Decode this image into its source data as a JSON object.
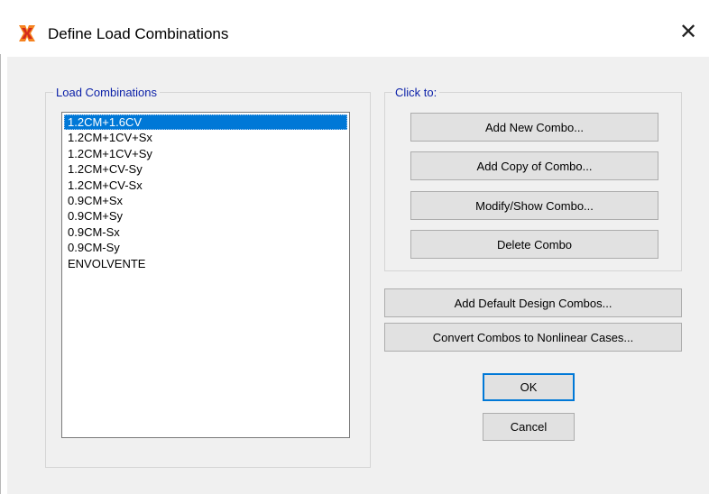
{
  "window": {
    "title": "Define Load Combinations",
    "close_glyph": "✕",
    "icon": "app-x-icon"
  },
  "load_combinations": {
    "label": "Load Combinations",
    "items": [
      "1.2CM+1.6CV",
      "1.2CM+1CV+Sx",
      "1.2CM+1CV+Sy",
      "1.2CM+CV-Sy",
      "1.2CM+CV-Sx",
      "0.9CM+Sx",
      "0.9CM+Sy",
      "0.9CM-Sx",
      "0.9CM-Sy",
      "ENVOLVENTE"
    ],
    "selected": "1.2CM+1.6CV"
  },
  "click_to": {
    "label": "Click to:",
    "add_new": "Add New Combo...",
    "add_copy": "Add Copy of Combo...",
    "modify_show": "Modify/Show Combo...",
    "delete": "Delete Combo"
  },
  "actions": {
    "add_default": "Add Default Design Combos...",
    "convert": "Convert Combos to Nonlinear Cases...",
    "ok": "OK",
    "cancel": "Cancel"
  },
  "colors": {
    "group_label": "#0a1fa8",
    "selection": "#0078d7",
    "icon_orange": "#f5821f",
    "icon_red": "#d42a1c"
  }
}
